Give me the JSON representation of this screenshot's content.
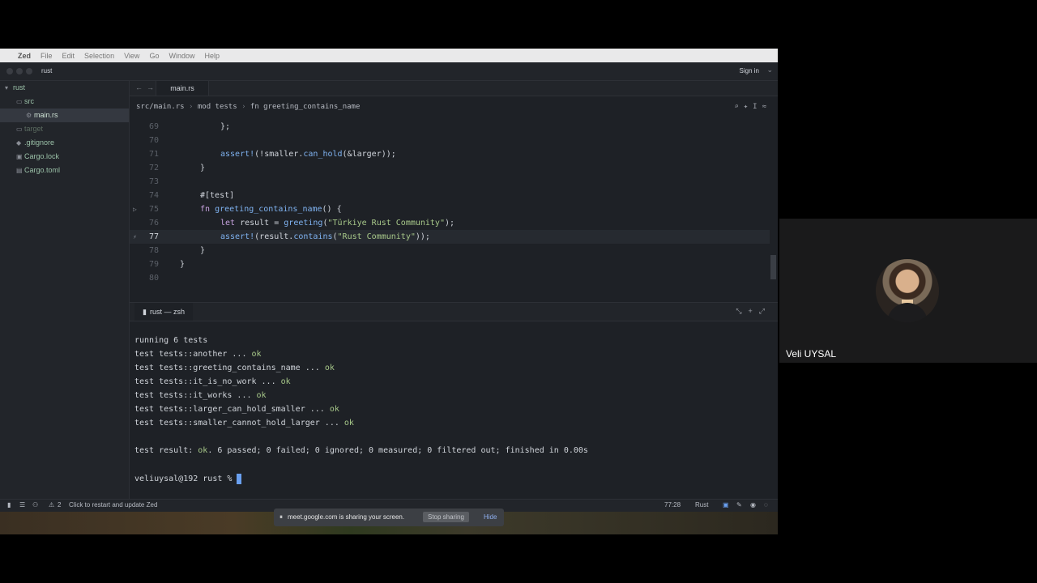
{
  "menubar": {
    "app": "Zed",
    "items": [
      "File",
      "Edit",
      "Selection",
      "View",
      "Go",
      "Window",
      "Help"
    ]
  },
  "titlebar": {
    "project": "rust",
    "signin": "Sign in"
  },
  "sidebar": {
    "items": [
      {
        "label": "rust",
        "icon": "chevron-down-icon"
      },
      {
        "label": "src",
        "icon": "folder-icon"
      },
      {
        "label": "main.rs",
        "icon": "rust-file-icon"
      },
      {
        "label": "target",
        "icon": "folder-icon"
      },
      {
        "label": ".gitignore",
        "icon": "git-icon"
      },
      {
        "label": "Cargo.lock",
        "icon": "lock-icon"
      },
      {
        "label": "Cargo.toml",
        "icon": "toml-icon"
      }
    ]
  },
  "tabs": {
    "active": "main.rs"
  },
  "breadcrumb": {
    "path": "src/main.rs",
    "sep": "›",
    "mod": "mod tests",
    "fn": "fn greeting_contains_name"
  },
  "editor": {
    "line_numbers": [
      "69",
      "70",
      "71",
      "72",
      "73",
      "74",
      "75",
      "76",
      "77",
      "78",
      "79",
      "80"
    ]
  },
  "terminal": {
    "tab": "rust — zsh",
    "lines": [
      "running 6 tests",
      "test tests::another ... ",
      "test tests::greeting_contains_name ... ",
      "test tests::it_is_no_work ... ",
      "test tests::it_works ... ",
      "test tests::larger_can_hold_smaller ... ",
      "test tests::smaller_cannot_hold_larger ... "
    ],
    "ok": "ok",
    "result_prefix": "test result: ",
    "result_rest": ". 6 passed; 0 failed; 0 ignored; 0 measured; 0 filtered out; finished in 0.00s",
    "prompt": "veliuysal@192 rust % "
  },
  "status": {
    "warnings": "2",
    "update": "Click to restart and update Zed",
    "position": "77:28",
    "language": "Rust"
  },
  "share": {
    "message": "meet.google.com is sharing your screen.",
    "stop": "Stop sharing",
    "hide": "Hide"
  },
  "participant": {
    "name": "Veli UYSAL"
  }
}
